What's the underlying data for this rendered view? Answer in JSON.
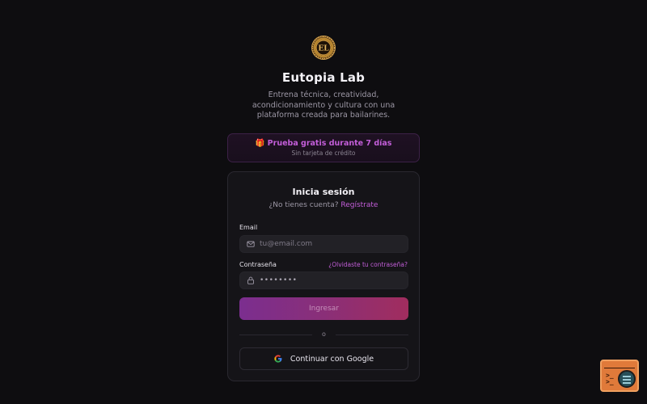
{
  "brand": {
    "name": "Eutopia Lab",
    "tagline_lines": [
      "Entrena técnica, creatividad,",
      "acondicionamiento y cultura con una",
      "plataforma creada para bailarines."
    ],
    "logo_monogram": "EL",
    "logo_icon": "medallion-logo-icon"
  },
  "trial": {
    "title": "🎁 Prueba gratis durante 7 días",
    "note": "Sin tarjeta de crédito"
  },
  "login": {
    "title": "Inicia sesión",
    "signup_prompt": "¿No tienes cuenta?",
    "signup_link": "Regístrate",
    "email_label": "Email",
    "email_placeholder": "tu@email.com",
    "email_value": "",
    "password_label": "Contraseña",
    "password_mask": "••••••••",
    "forgot_link": "¿Olvidaste tu contraseña?",
    "submit_label": "Ingresar",
    "divider_text": "o",
    "google_label": "Continuar con Google"
  },
  "icons": {
    "email": "mail-icon",
    "password": "lock-icon",
    "google": "google-icon",
    "corner": "terminal-search-icon"
  },
  "colors": {
    "background": "#0e0d10",
    "card": "#151418",
    "accent": "#c35ed9",
    "button_gradient_start": "#7b2e8f",
    "button_gradient_end": "#a12d5e",
    "logo_gold": "#d2a04a"
  }
}
